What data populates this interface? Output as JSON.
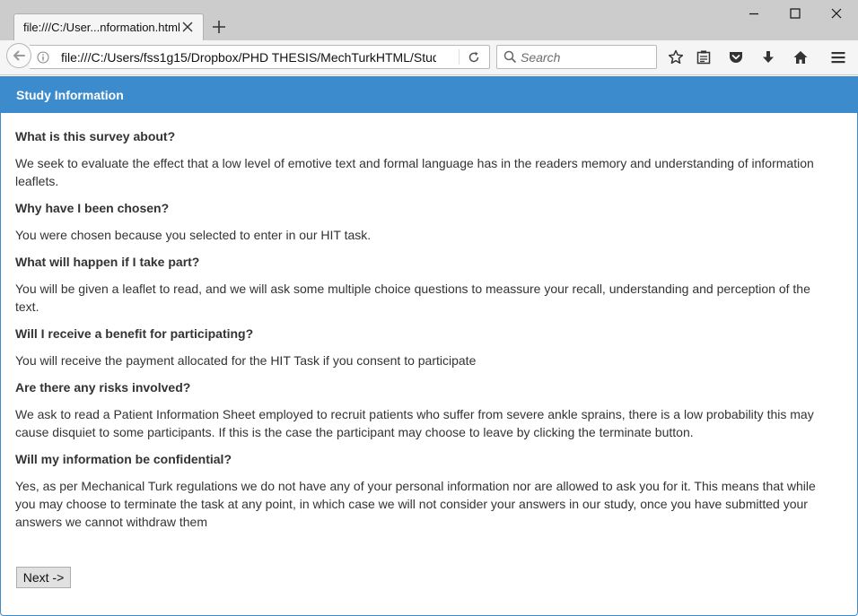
{
  "browser": {
    "tab_title": "file:///C:/User...nformation.html",
    "url": "file:///C:/Users/fss1g15/Dropbox/PHD THESIS/MechTurkHTML/Study",
    "search_placeholder": "Search",
    "icons": [
      "close-icon",
      "new-tab-icon",
      "minimize-icon",
      "maximize-icon",
      "window-close-icon",
      "back-arrow-icon",
      "info-icon",
      "reload-icon",
      "search-icon",
      "bookmark-star-icon",
      "reading-list-icon",
      "pocket-icon",
      "download-icon",
      "home-icon",
      "menu-icon"
    ]
  },
  "panel": {
    "title": "Study Information"
  },
  "sections": [
    {
      "heading": "What is this survey about?",
      "text": "We seek to evaluate the effect that a low level of emotive text and formal language has in the readers memory and understanding of information leaflets."
    },
    {
      "heading": "Why have I been chosen?",
      "text": "You were chosen because you selected to enter in our HIT task."
    },
    {
      "heading": "What will happen if I take part?",
      "text": "You will be given a leaflet to read, and we will ask some multiple choice questions to meassure your recall, understanding and perception of the text."
    },
    {
      "heading": "Will I receive a benefit for participating?",
      "text": "You will receive the payment allocated for the HIT Task if you consent to participate"
    },
    {
      "heading": "Are there any risks involved?",
      "text": "We ask to read a Patient Information Sheet employed to recruit patients who suffer from severe ankle sprains, there is a low probability this may cause disquiet to some participants. If this is the case the participant may choose to leave by clicking the terminate button."
    },
    {
      "heading": "Will my information be confidential?",
      "text": "Yes, as per Mechanical Turk regulations we do not have any of your personal information nor are allowed to ask you for it. This means that while you may choose to terminate the task at any point, in which case we will not consider your answers in our study, once you have submitted your answers we cannot withdraw them"
    }
  ],
  "next_button_label": "Next ->",
  "colors": {
    "header_blue": "#3c8bcd",
    "tabbar_gray": "#cccccc",
    "text": "#333333"
  }
}
